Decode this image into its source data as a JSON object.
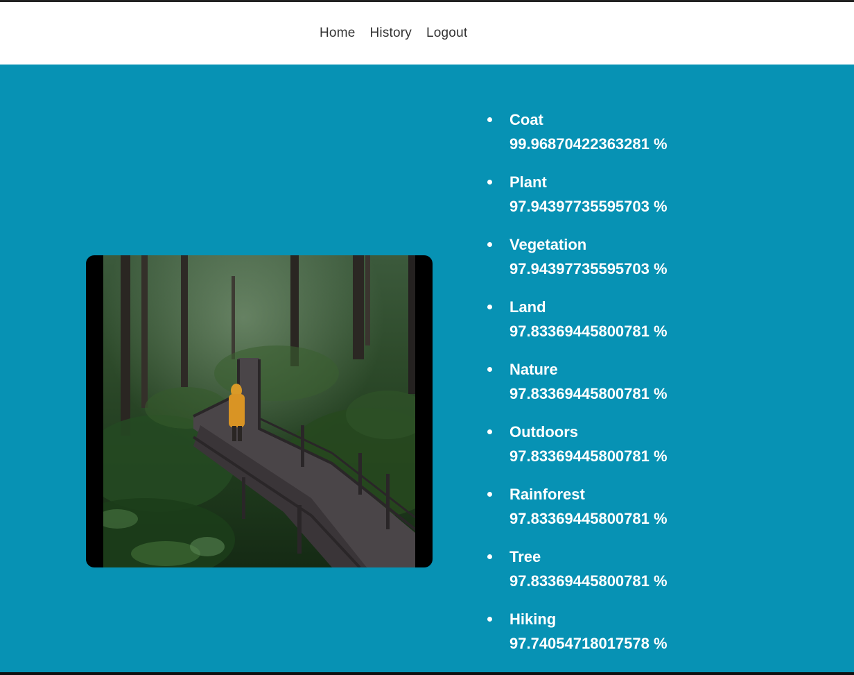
{
  "nav": {
    "home": "Home",
    "history": "History",
    "logout": "Logout"
  },
  "colors": {
    "background": "#0792b4",
    "navbar": "#ffffff",
    "text": "#ffffff"
  },
  "labels": [
    {
      "name": "Coat",
      "confidence": "99.96870422363281 %"
    },
    {
      "name": "Plant",
      "confidence": "97.94397735595703 %"
    },
    {
      "name": "Vegetation",
      "confidence": "97.94397735595703 %"
    },
    {
      "name": "Land",
      "confidence": "97.83369445800781 %"
    },
    {
      "name": "Nature",
      "confidence": "97.83369445800781 %"
    },
    {
      "name": "Outdoors",
      "confidence": "97.83369445800781 %"
    },
    {
      "name": "Rainforest",
      "confidence": "97.83369445800781 %"
    },
    {
      "name": "Tree",
      "confidence": "97.83369445800781 %"
    },
    {
      "name": "Hiking",
      "confidence": "97.74054718017578 %"
    }
  ]
}
